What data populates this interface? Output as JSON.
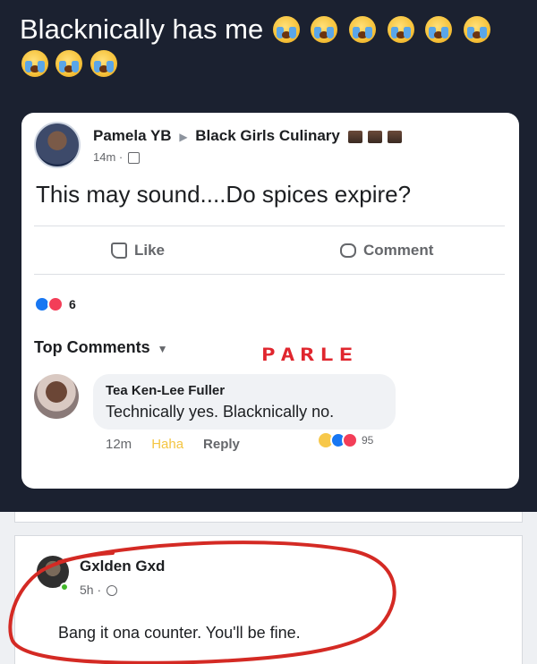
{
  "caption": {
    "text": "Blacknically has me",
    "emoji_count": 9,
    "emoji_name": "loudly-crying-face"
  },
  "post": {
    "author": "Pamela YB",
    "group": "Black Girls Culinary",
    "time": "14m",
    "text": "This may sound....Do spices expire?",
    "like_label": "Like",
    "comment_label": "Comment",
    "reaction_count": "6"
  },
  "comments": {
    "section_label": "Top Comments",
    "watermark": "PARLE",
    "top": {
      "author": "Tea Ken-Lee Fuller",
      "text": "Technically yes. Blacknically no.",
      "time": "12m",
      "haha_label": "Haha",
      "reply_label": "Reply",
      "reaction_count": "95"
    }
  },
  "reply_post": {
    "author": "Gxlden Gxd",
    "time": "5h",
    "text": "Bang it ona counter. You'll be fine."
  },
  "colors": {
    "facebook_blue": "#1877f2",
    "love_red": "#f33e58",
    "scribble_red": "#d42a24",
    "haha_yellow": "#f4c542"
  }
}
